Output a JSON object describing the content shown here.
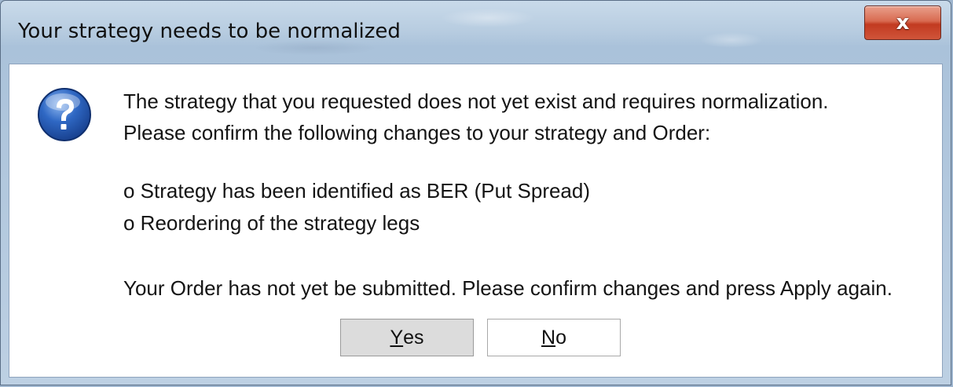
{
  "dialog": {
    "title": "Your strategy needs to be normalized",
    "close_label": "x",
    "icon": "question-icon",
    "message_line_1": "The strategy that you requested does not yet exist and requires normalization.",
    "message_line_2": "Please confirm the following changes to your strategy and Order:",
    "bullet_1": "o  Strategy has been identified as BER (Put Spread)",
    "bullet_2": "o  Reordering of the strategy legs",
    "footer_line": "Your Order has not yet be submitted. Please confirm changes and press Apply again.",
    "buttons": {
      "yes_mnemonic": "Y",
      "yes_rest": "es",
      "no_mnemonic": "N",
      "no_rest": "o"
    }
  }
}
